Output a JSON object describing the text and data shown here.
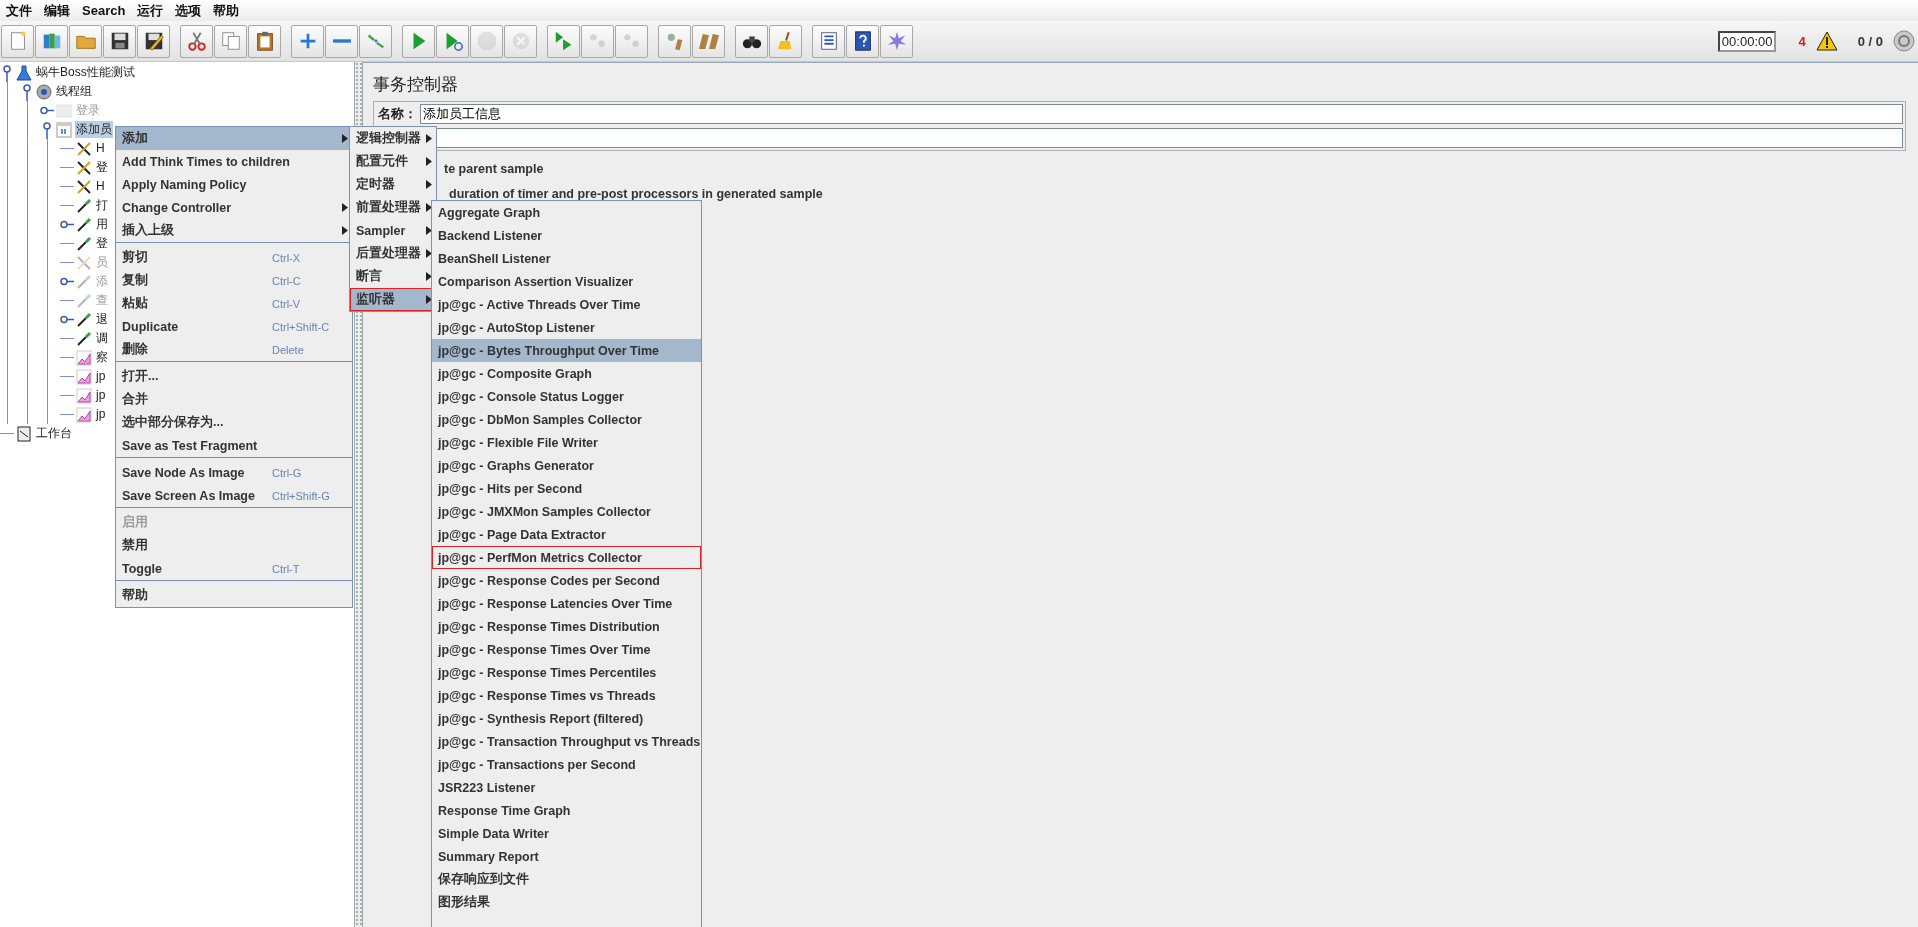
{
  "menubar": [
    "文件",
    "编辑",
    "Search",
    "运行",
    "选项",
    "帮助"
  ],
  "toolbar": {
    "groups": [
      [
        {
          "kind": "new",
          "disabled": false
        },
        {
          "kind": "templates",
          "disabled": false
        },
        {
          "kind": "open",
          "disabled": false
        },
        {
          "kind": "save",
          "disabled": false
        },
        {
          "kind": "save-as",
          "disabled": false
        }
      ],
      [
        {
          "kind": "cut",
          "disabled": false
        },
        {
          "kind": "copy",
          "disabled": false
        },
        {
          "kind": "paste",
          "disabled": false
        }
      ],
      [
        {
          "kind": "expand",
          "disabled": false
        },
        {
          "kind": "collapse",
          "disabled": false
        },
        {
          "kind": "toggle",
          "disabled": false
        }
      ],
      [
        {
          "kind": "start",
          "disabled": false
        },
        {
          "kind": "start-no-pauses",
          "disabled": false
        },
        {
          "kind": "stop",
          "disabled": true
        },
        {
          "kind": "shutdown",
          "disabled": true
        }
      ],
      [
        {
          "kind": "remote-start",
          "disabled": false
        },
        {
          "kind": "remote-stop",
          "disabled": true
        },
        {
          "kind": "remote-shutdown",
          "disabled": true
        }
      ],
      [
        {
          "kind": "clear",
          "disabled": false
        },
        {
          "kind": "clear-all",
          "disabled": false
        }
      ],
      [
        {
          "kind": "search",
          "disabled": false
        },
        {
          "kind": "reset-search",
          "disabled": false
        }
      ],
      [
        {
          "kind": "function-helper",
          "disabled": false
        },
        {
          "kind": "help",
          "disabled": false
        },
        {
          "kind": "logger",
          "disabled": false
        }
      ]
    ]
  },
  "status": {
    "elapsed_time": "00:00:00",
    "error_count": "4",
    "threads": "0 / 0"
  },
  "tree": [
    {
      "label": "蜗牛Boss性能测试",
      "kind": "test-plan",
      "expanded": true,
      "selected": false,
      "disabled": false,
      "children": [
        {
          "label": "线程组",
          "kind": "thread-group",
          "expanded": true,
          "selected": false,
          "disabled": false,
          "children": [
            {
              "label": "登录",
              "kind": "simple-controller",
              "expanded": false,
              "selected": false,
              "disabled": true
            },
            {
              "label": "添加员",
              "kind": "transaction-controller",
              "expanded": true,
              "selected": true,
              "disabled": false,
              "children": [
                {
                  "label": "H",
                  "kind": "config",
                  "selected": false,
                  "disabled": false
                },
                {
                  "label": "登",
                  "kind": "config",
                  "selected": false,
                  "disabled": false
                },
                {
                  "label": "H",
                  "kind": "config",
                  "selected": false,
                  "disabled": false
                },
                {
                  "label": "打",
                  "kind": "sampler",
                  "selected": false,
                  "disabled": false
                },
                {
                  "label": "用",
                  "kind": "sampler",
                  "expanded": false,
                  "selected": false,
                  "disabled": false
                },
                {
                  "label": "登",
                  "kind": "sampler",
                  "selected": false,
                  "disabled": false
                },
                {
                  "label": "员",
                  "kind": "config",
                  "selected": false,
                  "disabled": true
                },
                {
                  "label": "添",
                  "kind": "sampler",
                  "expanded": false,
                  "selected": false,
                  "disabled": true
                },
                {
                  "label": "查",
                  "kind": "sampler",
                  "selected": false,
                  "disabled": true
                },
                {
                  "label": "退",
                  "kind": "sampler",
                  "expanded": false,
                  "selected": false,
                  "disabled": false
                },
                {
                  "label": "调",
                  "kind": "sampler",
                  "selected": false,
                  "disabled": false
                },
                {
                  "label": "察",
                  "kind": "listener",
                  "selected": false,
                  "disabled": false
                },
                {
                  "label": "jp",
                  "kind": "listener",
                  "selected": false,
                  "disabled": false
                },
                {
                  "label": "jp",
                  "kind": "listener",
                  "selected": false,
                  "disabled": false
                },
                {
                  "label": "jp",
                  "kind": "listener",
                  "selected": false,
                  "disabled": false
                }
              ]
            }
          ]
        }
      ]
    },
    {
      "label": "工作台",
      "kind": "workbench",
      "selected": false,
      "disabled": false
    }
  ],
  "editor": {
    "title": "事务控制器",
    "name_label": "名称：",
    "name_value": "添加员工信息",
    "options": [
      "te parent sample",
      "duration of timer and pre-post processors in generated sample"
    ]
  },
  "context_menu": {
    "groups": [
      [
        {
          "label": "添加",
          "submenu": true,
          "selected": true,
          "disabled": false
        },
        {
          "label": "Add Think Times to children",
          "submenu": false,
          "selected": false,
          "disabled": false
        },
        {
          "label": "Apply Naming Policy",
          "submenu": false,
          "selected": false,
          "disabled": false
        },
        {
          "label": "Change Controller",
          "submenu": true,
          "selected": false,
          "disabled": false
        },
        {
          "label": "插入上级",
          "submenu": true,
          "selected": false,
          "disabled": false
        }
      ],
      [
        {
          "label": "剪切",
          "shortcut": "Ctrl-X",
          "submenu": false,
          "selected": false,
          "disabled": false
        },
        {
          "label": "复制",
          "shortcut": "Ctrl-C",
          "submenu": false,
          "selected": false,
          "disabled": false
        },
        {
          "label": "粘贴",
          "shortcut": "Ctrl-V",
          "submenu": false,
          "selected": false,
          "disabled": false
        },
        {
          "label": "Duplicate",
          "shortcut": "Ctrl+Shift-C",
          "submenu": false,
          "selected": false,
          "disabled": false
        },
        {
          "label": "删除",
          "shortcut": "Delete",
          "submenu": false,
          "selected": false,
          "disabled": false
        }
      ],
      [
        {
          "label": "打开...",
          "submenu": false,
          "selected": false,
          "disabled": false
        },
        {
          "label": "合并",
          "submenu": false,
          "selected": false,
          "disabled": false
        },
        {
          "label": "选中部分保存为...",
          "submenu": false,
          "selected": false,
          "disabled": false
        },
        {
          "label": "Save as Test Fragment",
          "submenu": false,
          "selected": false,
          "disabled": false
        }
      ],
      [
        {
          "label": "Save Node As Image",
          "shortcut": "Ctrl-G",
          "submenu": false,
          "selected": false,
          "disabled": false
        },
        {
          "label": "Save Screen As Image",
          "shortcut": "Ctrl+Shift-G",
          "submenu": false,
          "selected": false,
          "disabled": false
        }
      ],
      [
        {
          "label": "启用",
          "submenu": false,
          "selected": false,
          "disabled": true
        },
        {
          "label": "禁用",
          "submenu": false,
          "selected": false,
          "disabled": false
        },
        {
          "label": "Toggle",
          "shortcut": "Ctrl-T",
          "submenu": false,
          "selected": false,
          "disabled": false
        }
      ],
      [
        {
          "label": "帮助",
          "submenu": false,
          "selected": false,
          "disabled": false
        }
      ]
    ]
  },
  "add_submenu": {
    "items": [
      {
        "label": "逻辑控制器",
        "selected": false,
        "outlined": false
      },
      {
        "label": "配置元件",
        "selected": false,
        "outlined": false
      },
      {
        "label": "定时器",
        "selected": false,
        "outlined": false
      },
      {
        "label": "前置处理器",
        "selected": false,
        "outlined": false
      },
      {
        "label": "Sampler",
        "selected": false,
        "outlined": false
      },
      {
        "label": "后置处理器",
        "selected": false,
        "outlined": false
      },
      {
        "label": "断言",
        "selected": false,
        "outlined": false
      },
      {
        "label": "监听器",
        "selected": true,
        "outlined": true
      }
    ]
  },
  "listener_submenu": {
    "items": [
      {
        "label": "Aggregate Graph",
        "selected": false,
        "outlined": false
      },
      {
        "label": "Backend Listener",
        "selected": false,
        "outlined": false
      },
      {
        "label": "BeanShell Listener",
        "selected": false,
        "outlined": false
      },
      {
        "label": "Comparison Assertion Visualizer",
        "selected": false,
        "outlined": false
      },
      {
        "label": "jp@gc - Active Threads Over Time",
        "selected": false,
        "outlined": false
      },
      {
        "label": "jp@gc - AutoStop Listener",
        "selected": false,
        "outlined": false
      },
      {
        "label": "jp@gc - Bytes Throughput Over Time",
        "selected": true,
        "outlined": false
      },
      {
        "label": "jp@gc - Composite Graph",
        "selected": false,
        "outlined": false
      },
      {
        "label": "jp@gc - Console Status Logger",
        "selected": false,
        "outlined": false
      },
      {
        "label": "jp@gc - DbMon Samples Collector",
        "selected": false,
        "outlined": false
      },
      {
        "label": "jp@gc - Flexible File Writer",
        "selected": false,
        "outlined": false
      },
      {
        "label": "jp@gc - Graphs Generator",
        "selected": false,
        "outlined": false
      },
      {
        "label": "jp@gc - Hits per Second",
        "selected": false,
        "outlined": false
      },
      {
        "label": "jp@gc - JMXMon Samples Collector",
        "selected": false,
        "outlined": false
      },
      {
        "label": "jp@gc - Page Data Extractor",
        "selected": false,
        "outlined": false
      },
      {
        "label": "jp@gc - PerfMon Metrics Collector",
        "selected": false,
        "outlined": true
      },
      {
        "label": "jp@gc - Response Codes per Second",
        "selected": false,
        "outlined": false
      },
      {
        "label": "jp@gc - Response Latencies Over Time",
        "selected": false,
        "outlined": false
      },
      {
        "label": "jp@gc - Response Times Distribution",
        "selected": false,
        "outlined": false
      },
      {
        "label": "jp@gc - Response Times Over Time",
        "selected": false,
        "outlined": false
      },
      {
        "label": "jp@gc - Response Times Percentiles",
        "selected": false,
        "outlined": false
      },
      {
        "label": "jp@gc - Response Times vs Threads",
        "selected": false,
        "outlined": false
      },
      {
        "label": "jp@gc - Synthesis Report (filtered)",
        "selected": false,
        "outlined": false
      },
      {
        "label": "jp@gc - Transaction Throughput vs Threads",
        "selected": false,
        "outlined": false
      },
      {
        "label": "jp@gc - Transactions per Second",
        "selected": false,
        "outlined": false
      },
      {
        "label": "JSR223 Listener",
        "selected": false,
        "outlined": false
      },
      {
        "label": "Response Time Graph",
        "selected": false,
        "outlined": false
      },
      {
        "label": "Simple Data Writer",
        "selected": false,
        "outlined": false
      },
      {
        "label": "Summary Report",
        "selected": false,
        "outlined": false
      },
      {
        "label": "保存响应到文件",
        "selected": false,
        "outlined": false
      },
      {
        "label": "图形结果",
        "selected": false,
        "outlined": false
      }
    ]
  }
}
